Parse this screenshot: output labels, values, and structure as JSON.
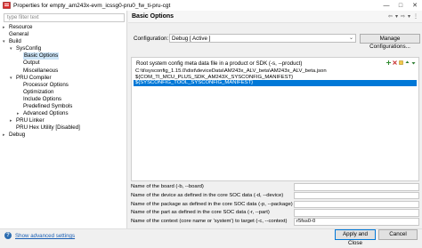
{
  "window": {
    "title": "Properties for empty_am243x-evm_icssg0-pru0_fw_ti-pru-cgt",
    "minimize": "—",
    "maximize": "□",
    "close": "✕"
  },
  "filter": {
    "placeholder": "type filter text"
  },
  "tree": [
    {
      "label": "Resource",
      "indent": 0,
      "arrow": "▸",
      "selected": false
    },
    {
      "label": "General",
      "indent": 0,
      "arrow": "",
      "selected": false
    },
    {
      "label": "Build",
      "indent": 0,
      "arrow": "▾",
      "selected": false
    },
    {
      "label": "SysConfig",
      "indent": 1,
      "arrow": "▾",
      "selected": false
    },
    {
      "label": "Basic Options",
      "indent": 2,
      "arrow": "",
      "selected": true
    },
    {
      "label": "Output",
      "indent": 2,
      "arrow": "",
      "selected": false
    },
    {
      "label": "Miscellaneous",
      "indent": 2,
      "arrow": "",
      "selected": false
    },
    {
      "label": "PRU Compiler",
      "indent": 1,
      "arrow": "▾",
      "selected": false
    },
    {
      "label": "Processor Options",
      "indent": 2,
      "arrow": "",
      "selected": false
    },
    {
      "label": "Optimization",
      "indent": 2,
      "arrow": "",
      "selected": false
    },
    {
      "label": "Include Options",
      "indent": 2,
      "arrow": "",
      "selected": false
    },
    {
      "label": "Predefined Symbols",
      "indent": 2,
      "arrow": "",
      "selected": false
    },
    {
      "label": "Advanced Options",
      "indent": 2,
      "arrow": "▸",
      "selected": false
    },
    {
      "label": "PRU Linker",
      "indent": 1,
      "arrow": "▸",
      "selected": false
    },
    {
      "label": "PRU Hex Utility  [Disabled]",
      "indent": 1,
      "arrow": "",
      "selected": false
    },
    {
      "label": "Debug",
      "indent": 0,
      "arrow": "▸",
      "selected": false
    }
  ],
  "header": {
    "title": "Basic Options"
  },
  "configuration": {
    "label": "Configuration:",
    "value": "Debug  [ Active ]",
    "manage_button": "Manage Configurations..."
  },
  "metadata_panel": {
    "title": "Root system config meta data file in a product or SDK (-s, --product)",
    "items": [
      {
        "text": "C:\\ti\\sysconfig_1.15.0\\dist\\deviceData\\AM243x_ALV_beta\\AM243x_ALV_beta.json",
        "selected": false
      },
      {
        "text": "${COM_TI_MCU_PLUS_SDK_AM243X_SYSCONFIG_MANIFEST}",
        "selected": false
      },
      {
        "text": "${SYSCONFIG_TOOL_SYSCONFIG_MANIFEST}",
        "selected": true
      }
    ]
  },
  "fields": [
    {
      "label": "Name of the board (-b, --board)",
      "value": ""
    },
    {
      "label": "Name of the device as defined in the core SOC data (-d, --device)",
      "value": ""
    },
    {
      "label": "Name of the package as defined in the core SOC data (-p, --package)",
      "value": ""
    },
    {
      "label": "Name of the part as defined in the core SOC data (-r, --part)",
      "value": ""
    },
    {
      "label": "Name of the context (core name or 'system') to target (-c, --context)",
      "value": "r5fss0-0"
    }
  ],
  "footer": {
    "advanced_link": "Show advanced settings",
    "apply_close": "Apply and Close",
    "cancel": "Cancel"
  },
  "colors": {
    "selection": "#0078d7",
    "tree_selection": "#cce4f7",
    "link": "#1a5fb4"
  }
}
